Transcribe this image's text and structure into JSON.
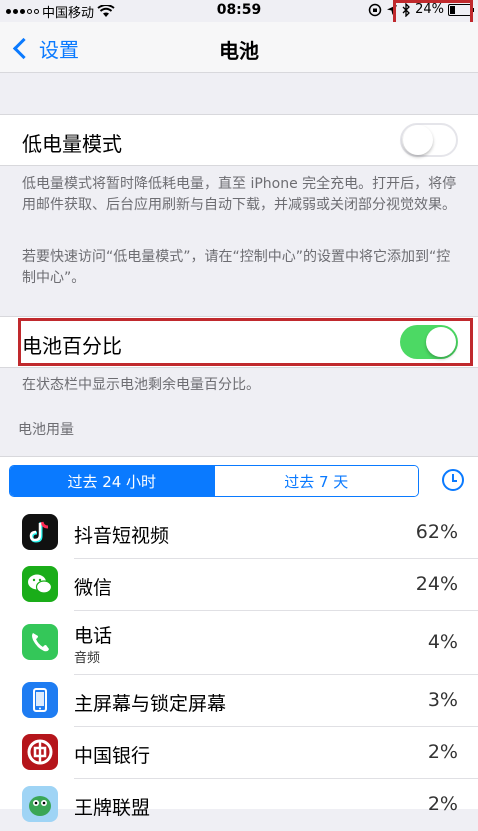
{
  "status_bar": {
    "carrier": "中国移动",
    "time": "08:59",
    "battery_percent": "24%",
    "battery_level": 0.24
  },
  "nav": {
    "back_label": "设置",
    "title": "电池"
  },
  "low_power": {
    "label": "低电量模式",
    "enabled": false,
    "footnote1": "低电量模式将暂时降低耗电量，直至 iPhone 完全充电。打开后，将停用邮件获取、后台应用刷新与自动下载，并减弱或关闭部分视觉效果。",
    "footnote2": "若要快速访问“低电量模式”，请在“控制中心”的设置中将它添加到“控制中心”。"
  },
  "battery_percentage": {
    "label": "电池百分比",
    "enabled": true,
    "footnote": "在状态栏中显示电池剩余电量百分比。"
  },
  "usage": {
    "header": "电池用量",
    "tabs": [
      "过去 24 小时",
      "过去 7 天"
    ],
    "active_tab": 0,
    "apps": [
      {
        "name": "抖音短视频",
        "sub": "",
        "percent": "62%",
        "icon": "douyin-icon"
      },
      {
        "name": "微信",
        "sub": "",
        "percent": "24%",
        "icon": "wechat-icon"
      },
      {
        "name": "电话",
        "sub": "音频",
        "percent": "4%",
        "icon": "phone-icon"
      },
      {
        "name": "主屏幕与锁定屏幕",
        "sub": "",
        "percent": "3%",
        "icon": "home-lock-screen-icon"
      },
      {
        "name": "中国银行",
        "sub": "",
        "percent": "2%",
        "icon": "bank-of-china-icon"
      },
      {
        "name": "王牌联盟",
        "sub": "",
        "percent": "2%",
        "icon": "game-icon"
      }
    ]
  },
  "colors": {
    "accent": "#0a7aff",
    "toggle_on": "#4cd964",
    "highlight_box": "#c0292d"
  }
}
